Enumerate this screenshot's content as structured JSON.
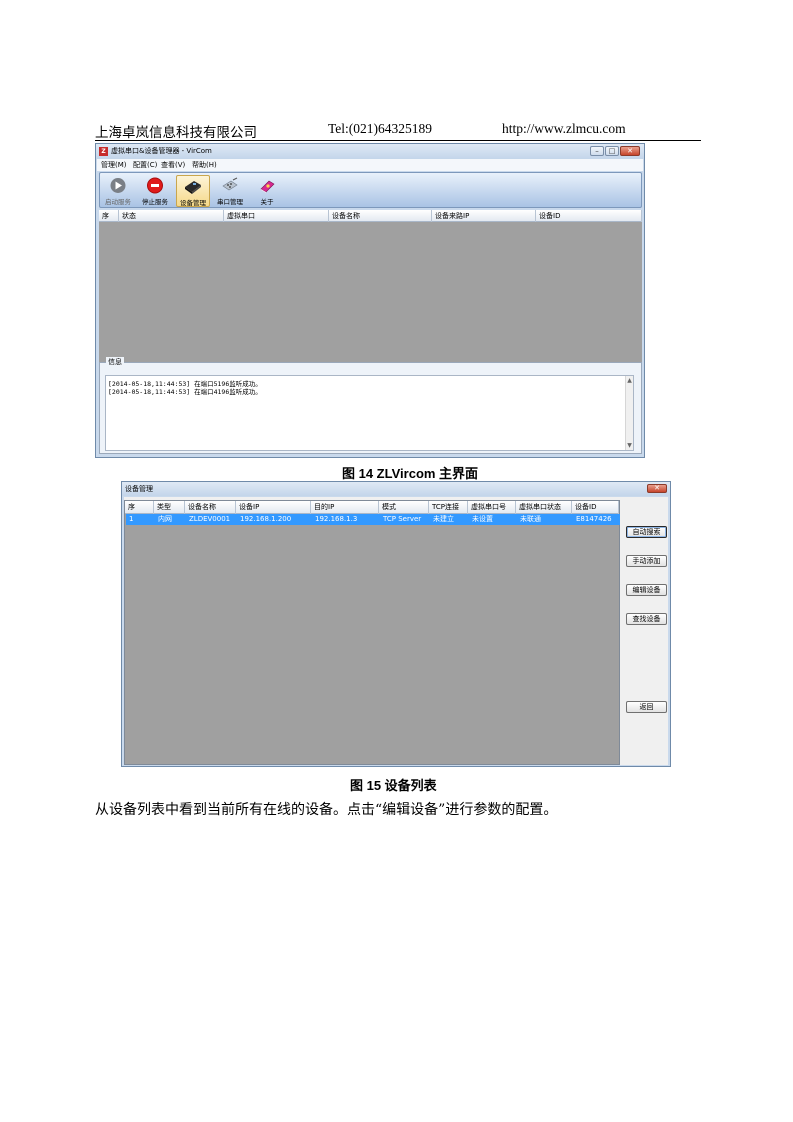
{
  "header": {
    "company": "上海卓岚信息科技有限公司",
    "tel": "Tel:(021)64325189",
    "url": "http://www.zlmcu.com"
  },
  "vircom": {
    "title": "虚拟串口&设备管理器 - VirCom",
    "menu": [
      "管理(M)",
      "配置(C)",
      "查看(V)",
      "帮助(H)"
    ],
    "toolbar": [
      {
        "label": "启动服务",
        "icon": "play-icon"
      },
      {
        "label": "停止服务",
        "icon": "stop-icon"
      },
      {
        "label": "设备管理",
        "icon": "device-manage-icon"
      },
      {
        "label": "串口管理",
        "icon": "serial-port-icon"
      },
      {
        "label": "关于",
        "icon": "about-book-icon"
      }
    ],
    "columns": [
      "序",
      "状态",
      "虚拟串口",
      "设备名称",
      "设备来路IP",
      "设备ID"
    ],
    "info_title": "信息",
    "log": [
      "[2014-05-18,11:44:53] 在端口5196监听成功。",
      "[2014-05-18,11:44:53] 在端口4196监听成功。"
    ]
  },
  "caption1": "图 14 ZLVircom 主界面",
  "device_mgr": {
    "title": "设备管理",
    "columns": [
      "序",
      "类型",
      "设备名称",
      "设备IP",
      "目的IP",
      "模式",
      "TCP连接",
      "虚拟串口号",
      "虚拟串口状态",
      "设备ID"
    ],
    "rows": [
      [
        "1",
        "内网",
        "ZLDEV0001",
        "192.168.1.200",
        "192.168.1.3",
        "TCP Server",
        "未建立",
        "未设置",
        "未联通",
        "E8147426"
      ]
    ],
    "buttons": {
      "auto_search": "自动搜索",
      "manual_add": "手动添加",
      "edit_device": "编辑设备",
      "find_device": "查找设备",
      "back": "返回"
    }
  },
  "caption2": "图 15 设备列表",
  "body_text": "从设备列表中看到当前所有在线的设备。点击“编辑设备”进行参数的配置。",
  "colors": {
    "selection": "#3399ff",
    "grid_bg": "#a0a0a0",
    "window_frame": "#c9d9ec"
  }
}
